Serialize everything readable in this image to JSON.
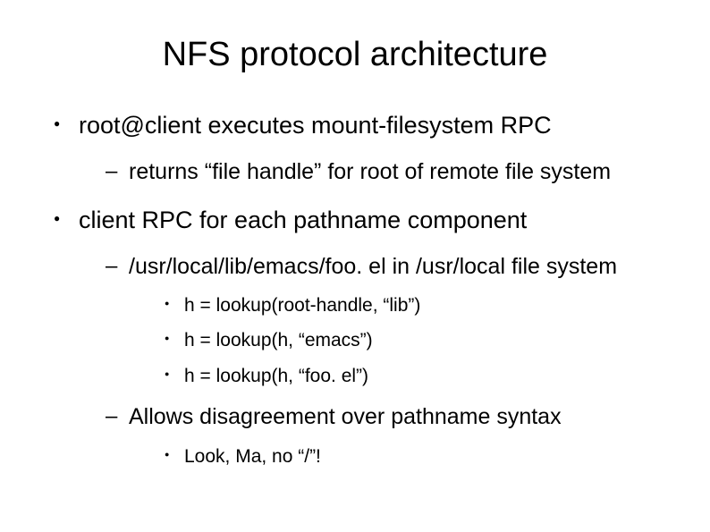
{
  "title": "NFS protocol architecture",
  "bullets": {
    "b1": "root@client executes mount-filesystem RPC",
    "b1_1": "returns “file handle” for root of remote file system",
    "b2": "client RPC for each pathname component",
    "b2_1": "/usr/local/lib/emacs/foo. el in /usr/local file system",
    "b2_1_1": "h = lookup(root-handle, “lib”)",
    "b2_1_2": "h = lookup(h, “emacs”)",
    "b2_1_3": "h = lookup(h, “foo. el”)",
    "b2_2": "Allows disagreement over pathname syntax",
    "b2_2_1": "Look, Ma, no “/”!"
  }
}
